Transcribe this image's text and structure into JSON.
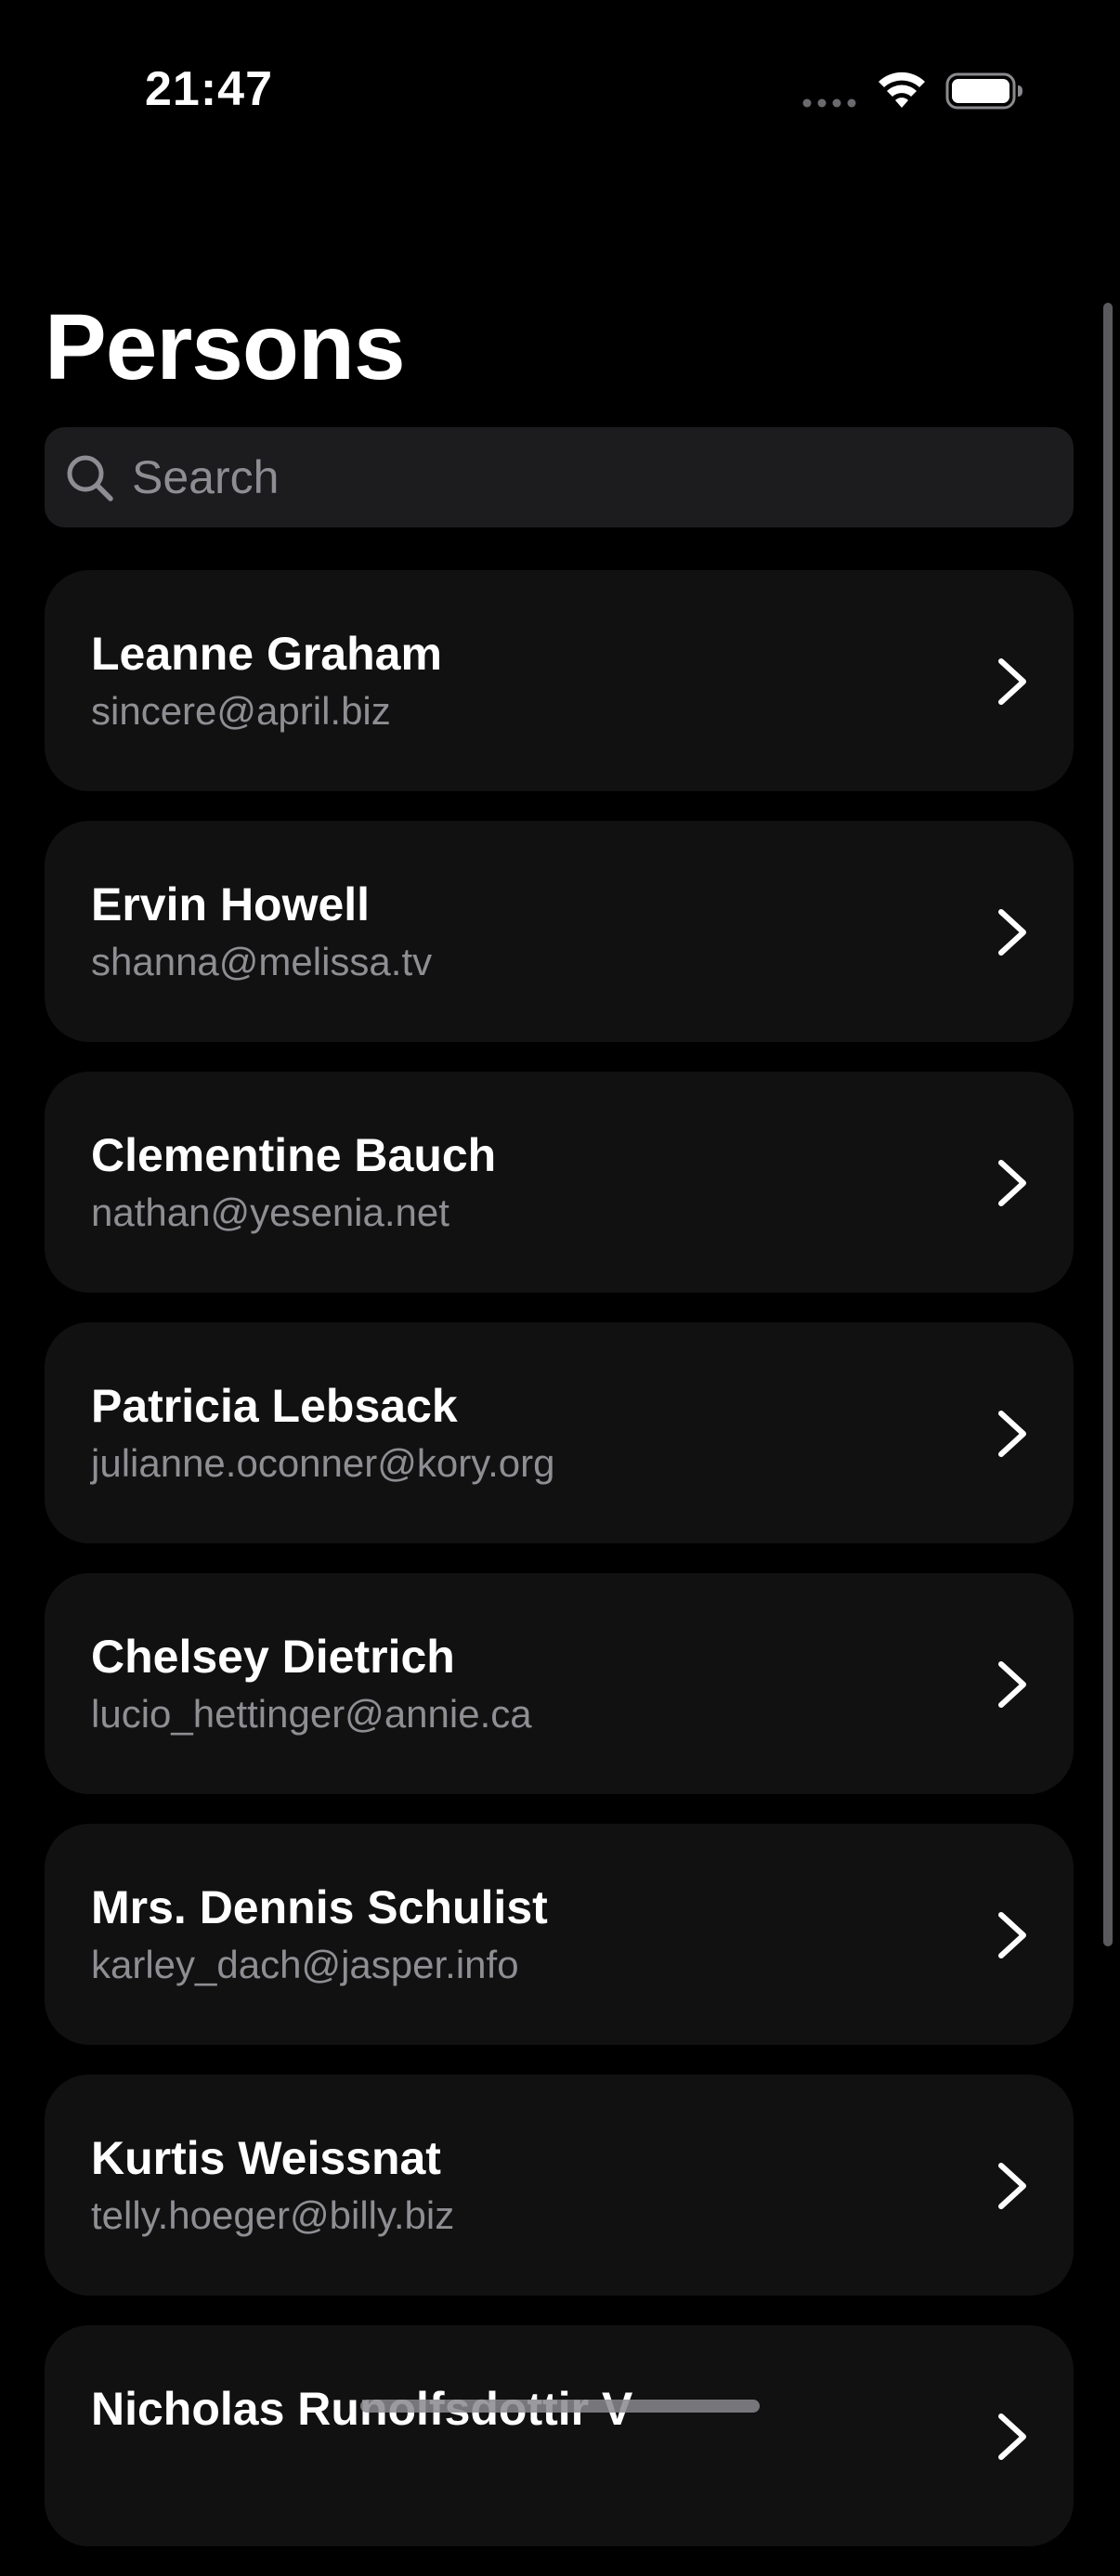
{
  "status_bar": {
    "time": "21:47"
  },
  "header": {
    "title": "Persons"
  },
  "search": {
    "placeholder": "Search",
    "value": ""
  },
  "persons": [
    {
      "name": "Leanne Graham",
      "email": "sincere@april.biz"
    },
    {
      "name": "Ervin Howell",
      "email": "shanna@melissa.tv"
    },
    {
      "name": "Clementine Bauch",
      "email": "nathan@yesenia.net"
    },
    {
      "name": "Patricia Lebsack",
      "email": "julianne.oconner@kory.org"
    },
    {
      "name": "Chelsey Dietrich",
      "email": "lucio_hettinger@annie.ca"
    },
    {
      "name": "Mrs. Dennis Schulist",
      "email": "karley_dach@jasper.info"
    },
    {
      "name": "Kurtis Weissnat",
      "email": "telly.hoeger@billy.biz"
    },
    {
      "name": "Nicholas Runolfsdottir V",
      "email": ""
    }
  ],
  "icons": {
    "search": "search-icon",
    "row_disclosure": "chevron-right-icon",
    "wifi": "wifi-icon",
    "battery": "battery-icon",
    "signal": "signal-dots-icon"
  },
  "colors": {
    "background": "#000000",
    "row_background": "#111112",
    "search_background": "#1c1c1e",
    "secondary_text": "#8e8e93"
  }
}
